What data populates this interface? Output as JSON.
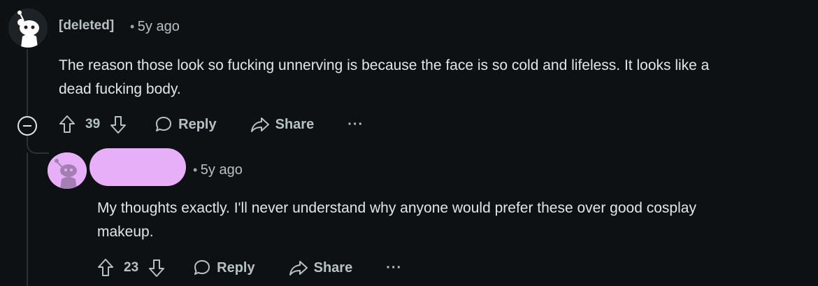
{
  "comments": [
    {
      "author": "[deleted]",
      "separator": "•",
      "time": "5y ago",
      "text_line1": "The reason those look so fucking unnerving is because the face is so cold and lifeless. It looks like a",
      "text_line2": "dead fucking body.",
      "votes": "39",
      "reply_label": "Reply",
      "share_label": "Share",
      "more_label": "···"
    },
    {
      "author": "",
      "separator": "•",
      "time": "5y ago",
      "text_line1": "My thoughts exactly. I'll never understand why anyone would prefer these over good cosplay",
      "text_line2": "makeup.",
      "votes": "23",
      "reply_label": "Reply",
      "share_label": "Share",
      "more_label": "···"
    }
  ],
  "colors": {
    "background": "#0e1113",
    "text": "#e3e6e8",
    "muted": "#b7c0c5",
    "redaction": "#e6aff8"
  },
  "icons": [
    "snoo-avatar-icon",
    "collapse-icon",
    "upvote-icon",
    "downvote-icon",
    "comment-bubble-icon",
    "share-arrow-icon",
    "more-icon"
  ]
}
